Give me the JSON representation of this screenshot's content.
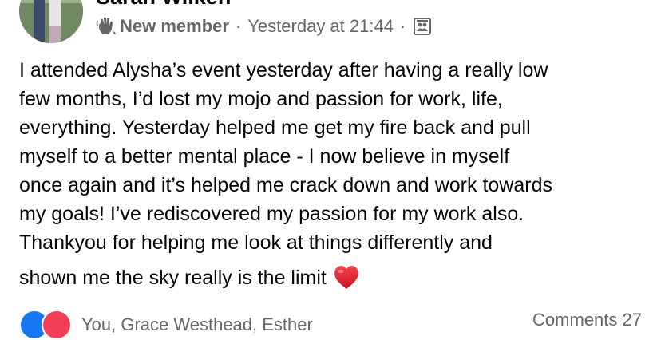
{
  "post": {
    "author_name": "Sarah Wilken",
    "member_badge": "New member",
    "separator": "·",
    "timestamp": "Yesterday at 21:44",
    "body_lines": [
      "I attended Alysha’s event yesterday after having a really low",
      "few months, I’d lost my mojo and passion for work, life,",
      "everything. Yesterday helped me get my fire back and pull",
      "myself to a better mental place - I now believe in myself",
      "once again and it’s helped me crack down and work towards",
      "my goals! I’ve rediscovered my passion for my work also.",
      "Thankyou for helping me look at things differently and"
    ],
    "body_last_line": "shown me the sky really is the limit",
    "reactions_text": "You, Grace Westhead, Esther",
    "comments_text": "Comments 27"
  },
  "icons": {
    "badge": "waving-hand-icon",
    "audience": "group-audience-icon",
    "more": "more-options-icon",
    "heart": "red-heart-emoji",
    "like": "like-reaction-icon",
    "love": "love-reaction-icon"
  },
  "colors": {
    "text_primary": "#050505",
    "text_secondary": "#65676b",
    "like_blue": "#1877f2",
    "love_red": "#f33e58",
    "heart_red": "#e0202b"
  }
}
